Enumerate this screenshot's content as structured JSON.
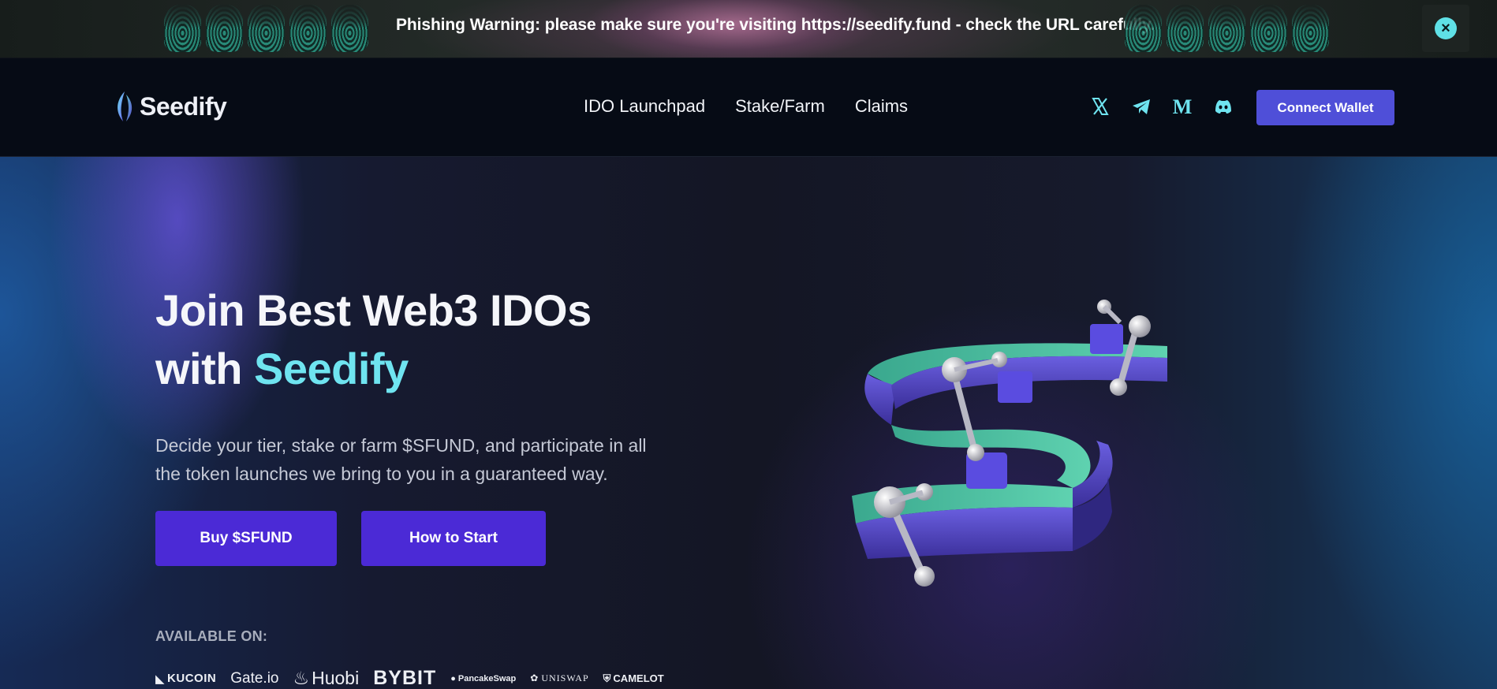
{
  "banner": {
    "text": "Phishing Warning: please make sure you're visiting https://seedify.fund - check the URL carefully.",
    "close_icon": "close-icon",
    "accent_color": "#5fe0e6"
  },
  "nav": {
    "logo_text": "Seedify",
    "links": [
      "IDO Launchpad",
      "Stake/Farm",
      "Claims"
    ],
    "socials": [
      "x-icon",
      "telegram-icon",
      "medium-icon",
      "discord-icon"
    ],
    "connect_label": "Connect Wallet",
    "connect_color": "#4f4fd8"
  },
  "hero": {
    "title_line1": "Join Best Web3 IDOs",
    "title_with": "with ",
    "title_accent": "Seedify",
    "accent_color": "#6fe4f0",
    "subtitle": "Decide your tier, stake or farm $SFUND, and participate in all the token launches we bring to you in a guaranteed way.",
    "buy_label": "Buy $SFUND",
    "start_label": "How to Start",
    "button_color": "#4b2ad6",
    "available_label": "AVAILABLE ON:",
    "exchanges": [
      "KUCOIN",
      "Gate.io",
      "Huobi",
      "BYBIT",
      "PancakeSwap",
      "UNISWAP",
      "CAMELOT"
    ]
  }
}
